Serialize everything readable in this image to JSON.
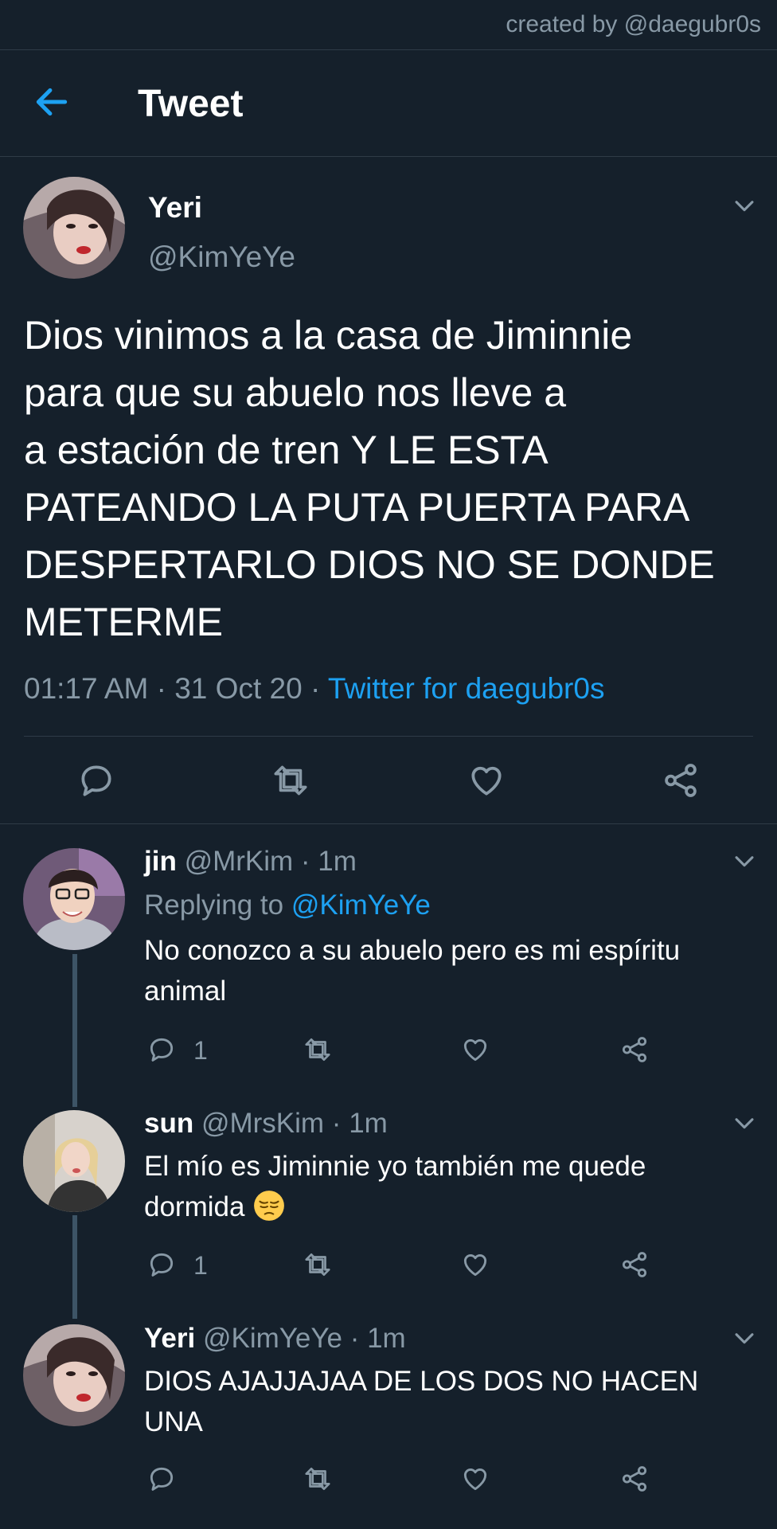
{
  "credit": "created by @daegubr0s",
  "header": {
    "title": "Tweet"
  },
  "main_tweet": {
    "name": "Yeri",
    "handle": "@KimYeYe",
    "text_lines": [
      "Dios vinimos a la casa de Jiminnie",
      "para que su abuelo nos lleve a",
      "a estación de tren Y LE ESTA",
      "PATEANDO LA PUTA PUERTA PARA",
      "DESPERTARLO DIOS NO SE DONDE",
      "METERME"
    ],
    "time": "01:17 AM",
    "sep1": " · ",
    "date": "31 Oct 20",
    "sep2": " · ",
    "source": "Twitter for daegubr0s"
  },
  "replies": [
    {
      "name": "jin",
      "meta": "@MrKim · 1m",
      "replying_prefix": "Replying to ",
      "replying_to": "@KimYeYe",
      "text_lines": [
        "No conozco a su abuelo pero es mi espíritu",
        "animal"
      ],
      "reply_count": "1"
    },
    {
      "name": "sun",
      "meta": "@MrsKim · 1m",
      "text_lines": [
        "El mío es Jiminnie yo también me quede",
        "dormida"
      ],
      "emoji": "pensive-face",
      "reply_count": "1"
    },
    {
      "name": "Yeri",
      "meta": "@KimYeYe · 1m",
      "text_lines": [
        "DIOS AJAJJAJAA DE LOS DOS NO HACEN",
        "UNA"
      ],
      "reply_count": ""
    }
  ],
  "colors": {
    "background": "#15202b",
    "accent": "#1da1f2",
    "muted": "#8899a6",
    "divider": "#2f3b47"
  }
}
